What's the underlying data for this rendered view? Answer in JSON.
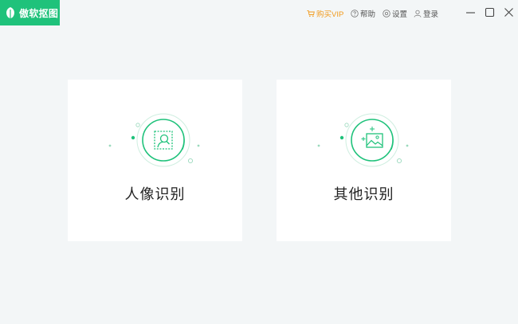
{
  "app": {
    "name": "傲软抠图",
    "icon": "leaf-logo-icon",
    "accent_color": "#1fc27b"
  },
  "header": {
    "buy_vip": {
      "label": "购买VIP",
      "icon": "cart-icon",
      "color": "#f29a1c"
    },
    "help": {
      "label": "帮助",
      "icon": "help-circle-icon"
    },
    "settings": {
      "label": "设置",
      "icon": "gear-icon"
    },
    "login": {
      "label": "登录",
      "icon": "user-icon"
    },
    "window_controls": [
      "minimize-icon",
      "maximize-icon",
      "close-icon"
    ]
  },
  "cards": [
    {
      "label": "人像识别",
      "icon": "portrait-recognition-icon"
    },
    {
      "label": "其他识别",
      "icon": "image-recognition-icon"
    }
  ]
}
